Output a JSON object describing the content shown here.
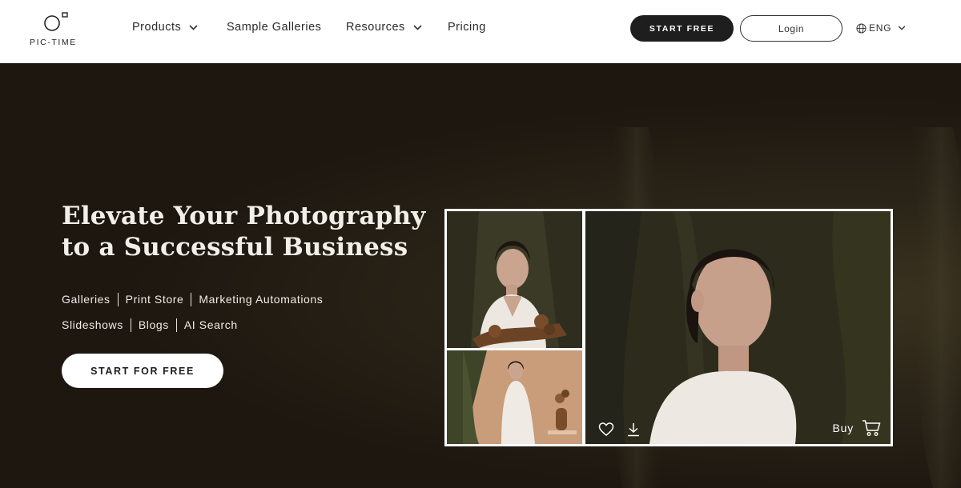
{
  "brand": {
    "name": "PIC-TIME"
  },
  "nav": {
    "items": [
      {
        "label": "Products",
        "has_dropdown": true
      },
      {
        "label": "Sample Galleries",
        "has_dropdown": false
      },
      {
        "label": "Resources",
        "has_dropdown": true
      },
      {
        "label": "Pricing",
        "has_dropdown": false
      }
    ],
    "start_label": "START FREE",
    "login_label": "Login",
    "language": "ENG"
  },
  "hero": {
    "title_line1": "Elevate Your Photography",
    "title_line2": "to a Successful Business",
    "features_row1": [
      "Galleries",
      "Print Store",
      "Marketing Automations"
    ],
    "features_row2": [
      "Slideshows",
      "Blogs",
      "AI Search"
    ],
    "cta_label": "START FOR FREE"
  },
  "gallery": {
    "buy_label": "Buy",
    "icons": [
      "heart-icon",
      "download-icon",
      "cart-icon"
    ]
  },
  "colors": {
    "hero_bg": "#1d1710",
    "header_bg": "#ffffff",
    "button_dark": "#1e1e1e"
  }
}
